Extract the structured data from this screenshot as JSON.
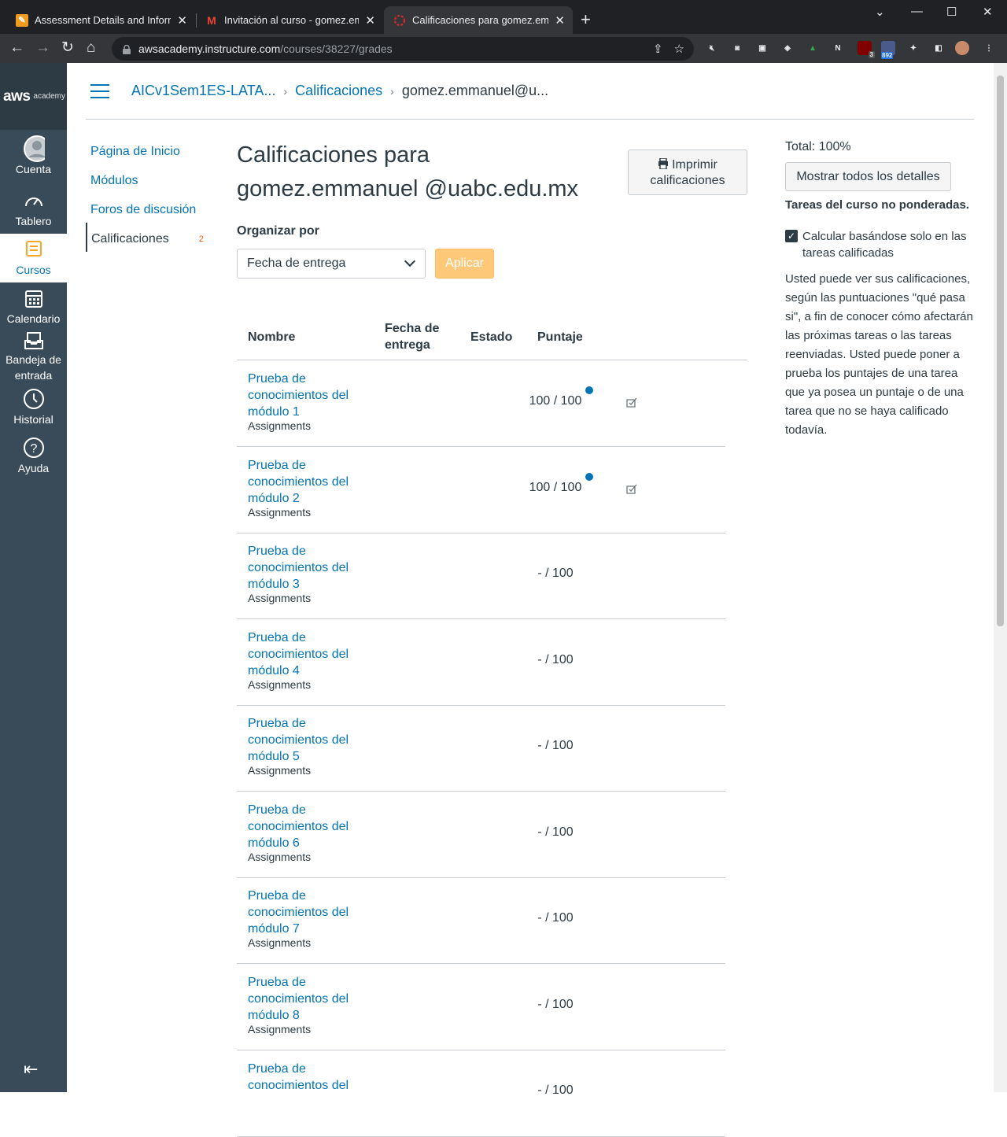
{
  "browser": {
    "tabs": [
      {
        "title": "Assessment Details and Informat",
        "favicon": "pencil-orange"
      },
      {
        "title": "Invitación al curso - gomez.emm",
        "favicon": "gmail"
      },
      {
        "title": "Calificaciones para gomez.emma",
        "favicon": "canvas-red"
      }
    ],
    "url_host": "awsacademy.instructure.com",
    "url_path": "/courses/38227/grades",
    "ext_badges": {
      "ublock": "3",
      "mail": "892"
    }
  },
  "global_nav": {
    "logo_main": "aws",
    "logo_sub": "academy",
    "items": [
      {
        "label": "Cuenta"
      },
      {
        "label": "Tablero"
      },
      {
        "label": "Cursos"
      },
      {
        "label": "Calendario"
      },
      {
        "label": "Bandeja de entrada"
      },
      {
        "label": "Historial"
      },
      {
        "label": "Ayuda"
      }
    ]
  },
  "breadcrumbs": [
    "AICv1Sem1ES-LATA...",
    "Calificaciones",
    "gomez.emmanuel@u..."
  ],
  "course_nav": {
    "items": [
      "Página de Inicio",
      "Módulos",
      "Foros de discusión",
      "Calificaciones"
    ],
    "badge": "2"
  },
  "page": {
    "title": "Calificaciones para gomez.emmanuel @uabc.edu.mx",
    "print_button": "Imprimir calificaciones",
    "organize_label": "Organizar por",
    "organize_value": "Fecha de entrega",
    "apply_button": "Aplicar"
  },
  "table": {
    "headers": [
      "Nombre",
      "Fecha de entrega",
      "Estado",
      "Puntaje"
    ],
    "rows": [
      {
        "name": "Prueba de conocimientos del módulo 1",
        "group": "Assignments",
        "score": "100 / 100",
        "graded": true
      },
      {
        "name": "Prueba de conocimientos del módulo 2",
        "group": "Assignments",
        "score": "100 / 100",
        "graded": true
      },
      {
        "name": "Prueba de conocimientos del módulo 3",
        "group": "Assignments",
        "score": "- / 100",
        "graded": false
      },
      {
        "name": "Prueba de conocimientos del módulo 4",
        "group": "Assignments",
        "score": "- / 100",
        "graded": false
      },
      {
        "name": "Prueba de conocimientos del módulo 5",
        "group": "Assignments",
        "score": "- / 100",
        "graded": false
      },
      {
        "name": "Prueba de conocimientos del módulo 6",
        "group": "Assignments",
        "score": "- / 100",
        "graded": false
      },
      {
        "name": "Prueba de conocimientos del módulo 7",
        "group": "Assignments",
        "score": "- / 100",
        "graded": false
      },
      {
        "name": "Prueba de conocimientos del módulo 8",
        "group": "Assignments",
        "score": "- / 100",
        "graded": false
      },
      {
        "name": "Prueba de conocimientos del",
        "group": "",
        "score": "- / 100",
        "graded": false
      }
    ]
  },
  "sidebar": {
    "total": "Total: 100%",
    "show_all_button": "Mostrar todos los detalles",
    "unweighted": "Tareas del curso no ponderadas.",
    "calc_checkbox": "Calcular basándose solo en las tareas calificadas",
    "calc_checked": true,
    "whatif_text": "Usted puede ver sus calificaciones, según las puntuaciones \"qué pasa si\", a fin de conocer cómo afectarán las próximas tareas o las tareas reenviadas. Usted puede poner a prueba los puntajes de una tarea que ya posea un puntaje o de una tarea que no se haya calificado todavía."
  },
  "colors": {
    "link": "#0374b5",
    "nav_bg": "#394b58",
    "apply_btn": "#fdc978"
  }
}
